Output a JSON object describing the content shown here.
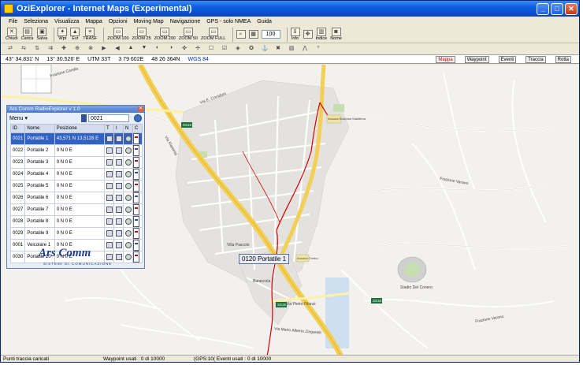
{
  "window": {
    "title": "OziExplorer - Internet Maps (Experimental)"
  },
  "menu": [
    "File",
    "Seleziona",
    "Visualizza",
    "Mappa",
    "Opzioni",
    "Moving Map",
    "Navigazione",
    "GPS - solo NMEA",
    "Guida"
  ],
  "toolbar": {
    "buttons": [
      {
        "icon": "close-icon",
        "glyph": "✕",
        "label": "Chiudi"
      },
      {
        "icon": "load-icon",
        "glyph": "▤",
        "label": "Carica"
      },
      {
        "icon": "save-icon",
        "glyph": "▣",
        "label": "Salva"
      },
      {
        "icon": "waypoint-icon",
        "glyph": "✦",
        "label": "Wpt"
      },
      {
        "icon": "event-icon",
        "glyph": "▲",
        "label": "Evt"
      },
      {
        "icon": "transfer-icon",
        "glyph": "≡",
        "label": "TRASF"
      },
      {
        "icon": "zoom-100-icon",
        "glyph": "▭",
        "label": "ZOOM 100"
      },
      {
        "icon": "zoom-25-icon",
        "glyph": "▭",
        "label": "ZOOM 25"
      },
      {
        "icon": "zoom-200-icon",
        "glyph": "▭",
        "label": "ZOOM 200"
      },
      {
        "icon": "zoom-50-icon",
        "glyph": "▭",
        "label": "ZOOM 50"
      },
      {
        "icon": "zoom-full-icon",
        "glyph": "▭",
        "label": "ZOOM FULL"
      },
      {
        "icon": "magnify-icon",
        "glyph": "⌕",
        "label": ""
      },
      {
        "icon": "select-icon",
        "glyph": "▦",
        "label": ""
      },
      {
        "icon": "info-icon",
        "glyph": "ℹ",
        "label": "Info"
      },
      {
        "icon": "pan-icon",
        "glyph": "✥",
        "label": ""
      },
      {
        "icon": "index-icon",
        "glyph": "▥",
        "label": "Indice"
      },
      {
        "icon": "name-icon",
        "glyph": "◙",
        "label": "Nome"
      }
    ],
    "zoom_value": "100"
  },
  "toolbar2": [
    "⇄",
    "⇆",
    "⇅",
    "⇉",
    "✚",
    "⊕",
    "⊗",
    "▶",
    "◀",
    "▲",
    "▼",
    "◐",
    "◑",
    "✜",
    "✢",
    "☐",
    "☑",
    "◈",
    "✪",
    "⚓",
    "✖",
    "▧",
    "⋀",
    "♆"
  ],
  "coords": {
    "lat": "43° 34.831' N",
    "lon": "13° 30.526' E",
    "utm": "UTM 33T",
    "east": "3 79 602E",
    "north": "48 26 364N",
    "datum": "WGS 84",
    "layers": [
      "Mappa",
      "Waypoint",
      "Eventi",
      "Traccia",
      "Rotta"
    ]
  },
  "radio": {
    "title": "Ars Comm RadioExplorer v 1.0",
    "menu_label": "Menu",
    "search_value": "0021",
    "columns": [
      "ID",
      "Nome",
      "Posizione",
      "T",
      "I",
      "N",
      "C"
    ],
    "rows": [
      {
        "id": "0021",
        "name": "Portatile 1",
        "pos": "43,571 N 13,5128 E",
        "sel": true
      },
      {
        "id": "0022",
        "name": "Portatile 2",
        "pos": "0 N 0 E"
      },
      {
        "id": "0023",
        "name": "Portatile 3",
        "pos": "0 N 0 E"
      },
      {
        "id": "0024",
        "name": "Portatile 4",
        "pos": "0 N 0 E"
      },
      {
        "id": "0025",
        "name": "Portatile 5",
        "pos": "0 N 0 E"
      },
      {
        "id": "0026",
        "name": "Portatile 6",
        "pos": "0 N 0 E"
      },
      {
        "id": "0027",
        "name": "Portatile 7",
        "pos": "0 N 0 E"
      },
      {
        "id": "0028",
        "name": "Portatile 8",
        "pos": "0 N 0 E"
      },
      {
        "id": "0029",
        "name": "Portatile 9",
        "pos": "0 N 0 E"
      },
      {
        "id": "0001",
        "name": "Veicolare 1",
        "pos": "0 N 0 E"
      },
      {
        "id": "0030",
        "name": "Portatile 10",
        "pos": "0 N 0 E"
      }
    ],
    "logo": "Ars Comm",
    "logo_sub": "SISTEMI DI COMUNICAZIONE"
  },
  "map": {
    "marker_label": "0120 Portatile 1",
    "road_labels": [
      "SS16",
      "SS16",
      "SS16",
      "Via Flaminia",
      "Via E. Corridoni",
      "Via Pietro Filonzi",
      "Frazione Varano",
      "Frazione Candia",
      "Ancona Centro",
      "Baraccola",
      "Stadio Del Conero",
      "Via Mario Alberto Zingarelli",
      "Ancona Stazione Marittima",
      "Frazione Varano",
      "Villa Pascolo"
    ]
  },
  "status": {
    "left": "Punti traccia caricati",
    "middle": "Waypoint usati : 0 di 10000",
    "right": "(GPS:10( Eventi usati : 0 di 10000"
  }
}
